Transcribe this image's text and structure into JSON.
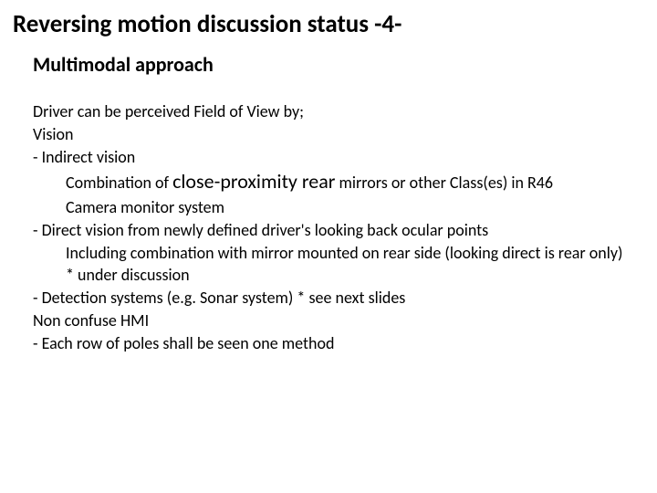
{
  "title": "Reversing motion discussion status -4-",
  "subtitle": "Multimodal approach",
  "body": {
    "intro1": "Driver can be perceived Field of View by;",
    "intro2": "Vision",
    "b1_prefix": "-    Indirect vision",
    "b1_line2_a": "Combination of ",
    "b1_line2_b": "close-proximity rear",
    "b1_line2_c": " mirrors or other Class(es) in R46",
    "b1_line3": "Camera monitor system",
    "b2_prefix": "-    Direct vision from newly defined driver's looking back ocular points",
    "b2_line2": "Including combination with mirror mounted on rear side (looking direct is rear only)",
    "b2_line3": "* under discussion",
    "b3_prefix": "-    Detection systems (e.g. Sonar system) * see next slides",
    "hmi1": "Non confuse HMI",
    "hmi2": "- Each row of poles shall be seen one method"
  }
}
